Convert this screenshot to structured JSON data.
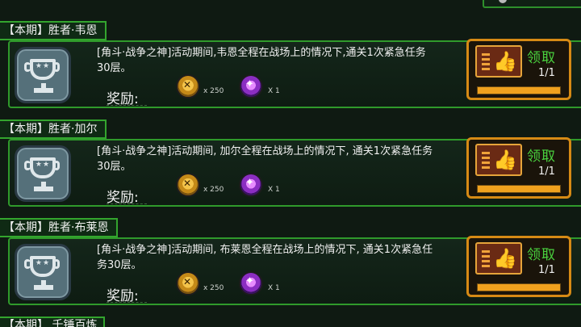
{
  "quests": [
    {
      "tab": "【本期】胜者·韦恩",
      "desc": "[角斗·战争之神]活动期间,韦恩全程在战场上的情况下,通关1次紧急任务30层。",
      "reward_label": "奖励:",
      "reward1_qty": "x 250",
      "reward2_qty": "X 1",
      "claim_label": "领取",
      "progress_text": "1/1",
      "progress": 1.0
    },
    {
      "tab": "【本期】胜者·加尔",
      "desc": "[角斗·战争之神]活动期间, 加尔全程在战场上的情况下, 通关1次紧急任务30层。",
      "reward_label": "奖励:",
      "reward1_qty": "x 250",
      "reward2_qty": "X 1",
      "claim_label": "领取",
      "progress_text": "1/1",
      "progress": 1.0
    },
    {
      "tab": "【本期】胜者·布莱恩",
      "desc": "[角斗·战争之神]活动期间, 布莱恩全程在战场上的情况下, 通关1次紧急任务30层。",
      "reward_label": "奖励:",
      "reward1_qty": "x 250",
      "reward2_qty": "X 1",
      "claim_label": "领取",
      "progress_text": "1/1",
      "progress": 1.0
    }
  ],
  "next_tab": "【本期】 千锤百炼",
  "icons": {
    "badge": "trophy-icon",
    "reward1": "gold-coin-icon",
    "reward2": "purple-gem-icon",
    "claim": "thumbs-up-icon"
  },
  "colors": {
    "border": "#2f9a2b",
    "claim_border": "#d68a15",
    "claim_text": "#49d13e",
    "progress_fill": "#f0a11e"
  }
}
